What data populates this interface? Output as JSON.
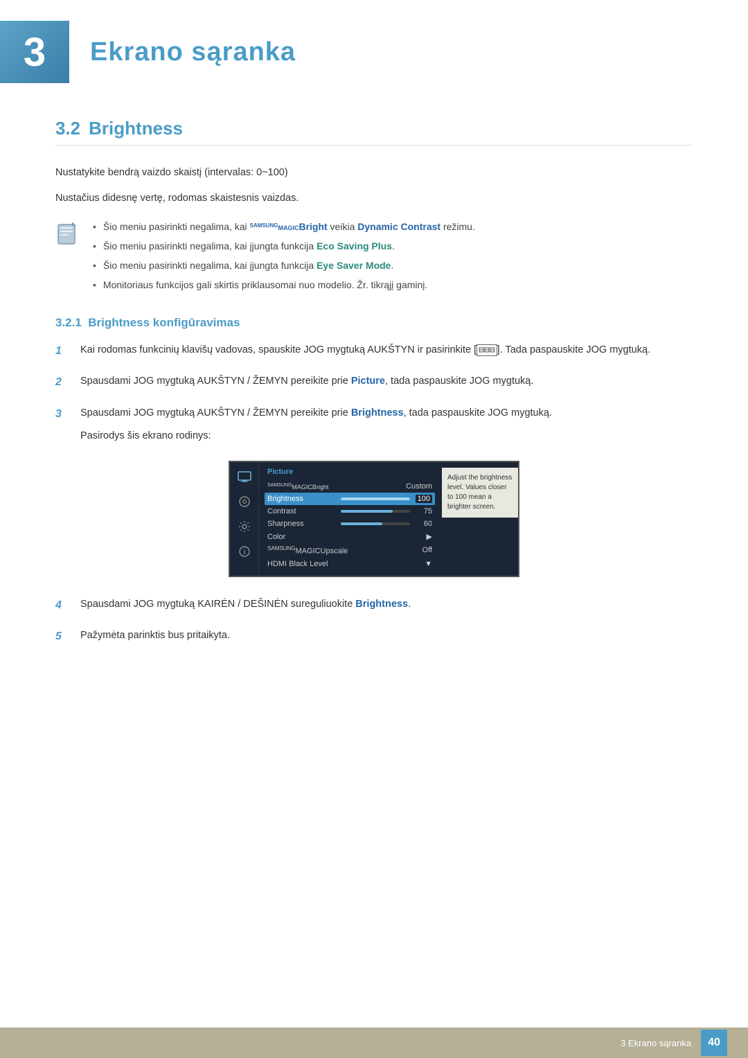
{
  "chapter": {
    "number": "3",
    "title": "Ekrano sąranka"
  },
  "section": {
    "number": "3.2",
    "title": "Brightness"
  },
  "subsection": {
    "number": "3.2.1",
    "title": "Brightness konfigūravimas"
  },
  "intro_text_1": "Nustatykite bendrą vaizdo skaistį (intervalas: 0~100)",
  "intro_text_2": "Nustačius didesnę vertę, rodomas skaistesnis vaizdas.",
  "notes": [
    {
      "id": 1,
      "text_before": "Šio meniu pasirinkti negalima, kai ",
      "samsung_magic": "SAMSUNG MAGIC",
      "bold_colored": "Bright",
      "text_middle": " veikia ",
      "bold_blue": "Dynamic Contrast",
      "text_after": " režimu."
    },
    {
      "id": 2,
      "text_before": "Šio meniu pasirinkti negalima, kai įjungta funkcija ",
      "bold_teal": "Eco Saving Plus",
      "text_after": "."
    },
    {
      "id": 3,
      "text_before": "Šio meniu pasirinkti negalima, kai įjungta funkcija ",
      "bold_teal": "Eye Saver Mode",
      "text_after": "."
    },
    {
      "id": 4,
      "text": "Monitoriaus funkcijos gali skirtis priklausomai nuo modelio. Žr. tikrąjį gaminį."
    }
  ],
  "steps": [
    {
      "number": "1",
      "text_before": "Kai rodomas funkcinių klavišų vadovas, spauskite JOG mygtuką AUKŠTYN ir pasirinkite [",
      "icon": "□□□",
      "text_after": "]. Tada paspauskite JOG mygtuką."
    },
    {
      "number": "2",
      "text": "Spausdami JOG mygtuką AUKŠTYN / ŽEMYN pereikite prie ",
      "bold_blue": "Picture",
      "text_after": ", tada paspauskite JOG mygtuką."
    },
    {
      "number": "3",
      "text": "Spausdami JOG mygtuką AUKŠTYN / ŽEMYN pereikite prie ",
      "bold_blue": "Brightness",
      "text_after": ", tada paspauskite JOG mygtuką.",
      "screen_note": "Pasirodys šis ekrano rodinys:"
    },
    {
      "number": "4",
      "text": "Spausdami JOG mygtuką KAIRĖN / DEŠINĖN sureguliuokite ",
      "bold_blue": "Brightness",
      "text_after": "."
    },
    {
      "number": "5",
      "text": "Pažymėta parinktis bus pritaikyta."
    }
  ],
  "screen_mockup": {
    "category": "Picture",
    "magic_bright_label": "MAGICBright",
    "magic_bright_super": "SAMSUNG",
    "magic_bright_value": "Custom",
    "rows": [
      {
        "label": "Brightness",
        "bar_pct": 100,
        "value": "100",
        "active": true
      },
      {
        "label": "Contrast",
        "bar_pct": 75,
        "value": "75",
        "active": false
      },
      {
        "label": "Sharpness",
        "bar_pct": 60,
        "value": "60",
        "active": false
      },
      {
        "label": "Color",
        "bar_pct": 0,
        "value": "▶",
        "active": false
      },
      {
        "label": "MAGICUpscale",
        "bar_pct": 0,
        "value": "Off",
        "active": false
      },
      {
        "label": "HDMI Black Level",
        "bar_pct": 0,
        "value": "▼",
        "active": false
      }
    ],
    "tooltip": "Adjust the brightness level. Values closer to 100 mean a brighter screen."
  },
  "footer": {
    "text": "3 Ekrano sąranka",
    "page": "40"
  }
}
